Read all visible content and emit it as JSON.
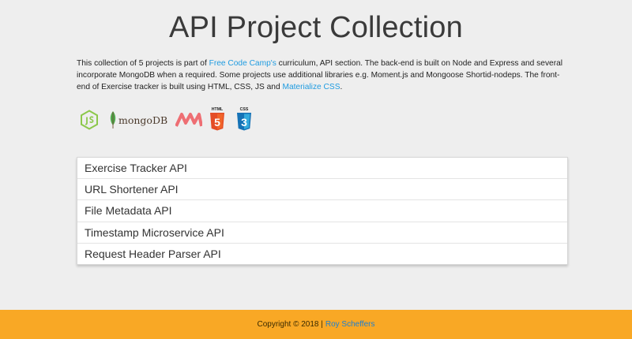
{
  "header": {
    "title": "API Project Collection"
  },
  "intro": {
    "text_1": "This collection of 5 projects is part of ",
    "link_fcc": "Free Code Camp's",
    "text_2": " curriculum, API section. The back-end is built on Node and Express and several incorporate MongoDB when a required. Some projects use additional libraries e.g. Moment.js and Mongoose Shortid-nodeps. The front-end of Exercise tracker is built using HTML, CSS, JS and ",
    "link_materialize": "Materialize CSS",
    "text_3": "."
  },
  "logos": {
    "mongodb_text": "mongoDB",
    "html5_caption": "HTML",
    "css3_caption": "CSS",
    "html5_number": "5",
    "css3_number": "3",
    "icons": [
      "nodejs-icon",
      "mongodb-leaf-icon",
      "materialize-icon",
      "html5-icon",
      "css3-icon"
    ]
  },
  "projects": [
    {
      "label": "Exercise Tracker API"
    },
    {
      "label": "URL Shortener API"
    },
    {
      "label": "File Metadata API"
    },
    {
      "label": "Timestamp Microservice API"
    },
    {
      "label": "Request Header Parser API"
    }
  ],
  "footer": {
    "copyright": "Copyright © 2018 |",
    "author_link": "Roy Scheffers"
  },
  "colors": {
    "footer_bg": "#f9a825",
    "link": "#1e9be0",
    "page_bg": "#eeeeee"
  }
}
